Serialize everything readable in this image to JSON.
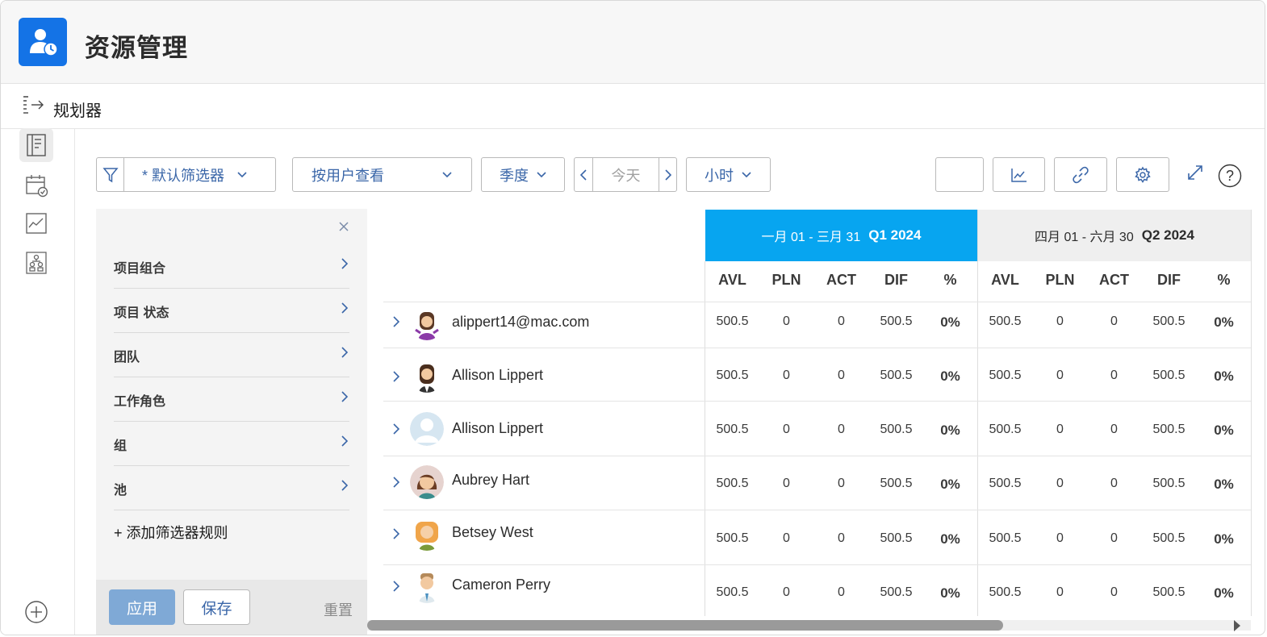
{
  "app": {
    "title": "资源管理",
    "logo_icon": "user-clock-icon",
    "accent": "#1473e6"
  },
  "subheader": {
    "title": "规划器",
    "icon": "collapse-arrow-icon"
  },
  "rail": {
    "items": [
      {
        "name": "planner-icon",
        "active": true
      },
      {
        "name": "calendar-check-icon",
        "active": false
      },
      {
        "name": "line-chart-icon",
        "active": false
      },
      {
        "name": "org-chart-icon",
        "active": false
      }
    ],
    "add_icon": "plus-circle-icon"
  },
  "toolbar": {
    "filter_label": "* 默认筛选器",
    "view_label": "按用户查看",
    "period_label": "季度",
    "today_label": "今天",
    "unit_label": "小时"
  },
  "filter_panel": {
    "items": [
      "项目组合",
      "项目 状态",
      "团队",
      "工作角色",
      "组",
      "池"
    ],
    "add_rule": "+ 添加筛选器规则",
    "apply": "应用",
    "save": "保存",
    "reset": "重置",
    "apply_color": "#7fa9d6"
  },
  "grid": {
    "quarters": [
      {
        "range": "一月 01 - 三月 31",
        "label": "Q1 2024",
        "color": "#07a5f0"
      },
      {
        "range": "四月 01 - 六月 30",
        "label": "Q2 2024",
        "color": "#efefef"
      }
    ],
    "columns": [
      "AVL",
      "PLN",
      "ACT",
      "DIF",
      "%"
    ],
    "rows": [
      {
        "name": "alippert14@mac.com",
        "q1": [
          "500.5",
          "0",
          "0",
          "500.5",
          "0%"
        ],
        "q2": [
          "500.5",
          "0",
          "0",
          "500.5",
          "0%"
        ]
      },
      {
        "name": "Allison Lippert",
        "q1": [
          "500.5",
          "0",
          "0",
          "500.5",
          "0%"
        ],
        "q2": [
          "500.5",
          "0",
          "0",
          "500.5",
          "0%"
        ]
      },
      {
        "name": "Allison Lippert",
        "q1": [
          "500.5",
          "0",
          "0",
          "500.5",
          "0%"
        ],
        "q2": [
          "500.5",
          "0",
          "0",
          "500.5",
          "0%"
        ]
      },
      {
        "name": "Aubrey Hart",
        "q1": [
          "500.5",
          "0",
          "0",
          "500.5",
          "0%"
        ],
        "q2": [
          "500.5",
          "0",
          "0",
          "500.5",
          "0%"
        ]
      },
      {
        "name": "Betsey West",
        "q1": [
          "500.5",
          "0",
          "0",
          "500.5",
          "0%"
        ],
        "q2": [
          "500.5",
          "0",
          "0",
          "500.5",
          "0%"
        ]
      },
      {
        "name": "Cameron Perry",
        "q1": [
          "500.5",
          "0",
          "0",
          "500.5",
          "0%"
        ],
        "q2": [
          "500.5",
          "0",
          "0",
          "500.5",
          "0%"
        ]
      }
    ]
  }
}
